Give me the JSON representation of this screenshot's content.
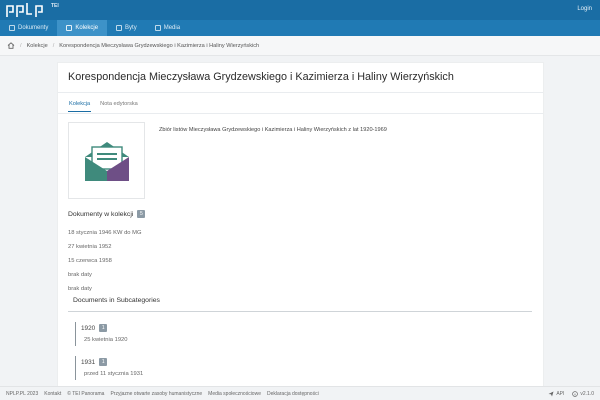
{
  "header": {
    "logo_tei": "TEI",
    "login": "Login"
  },
  "nav": {
    "items": [
      {
        "label": "Dokumenty",
        "icon": "document-icon",
        "active": false
      },
      {
        "label": "Kolekcje",
        "icon": "collection-icon",
        "active": true
      },
      {
        "label": "Byty",
        "icon": "entity-icon",
        "active": false
      },
      {
        "label": "Media",
        "icon": "media-icon",
        "active": false
      }
    ]
  },
  "breadcrumb": {
    "home_icon": "home-icon",
    "items": [
      "Kolekcje",
      "Korespondencja Mieczysława Grydzewskiego i Kazimierza i Haliny Wierzyńskich"
    ]
  },
  "collection": {
    "title": "Korespondencja Mieczysława Grydzewskiego i Kazimierza i Haliny Wierzyńskich",
    "tabs": [
      {
        "label": "Kolekcja",
        "active": true
      },
      {
        "label": "Nota edytorska",
        "active": false
      }
    ],
    "description": "Zbiór listów Mieczysława Grydzewskiego i Kazimierza i Haliny Wierzyńskich z lat 1920-1969",
    "documents_heading": "Dokumenty w kolekcji",
    "documents_count": "5",
    "documents": [
      "18 stycznia 1946 KW do MG",
      "27 kwietnia 1952",
      "15 czerwca 1958",
      "brak daty",
      "brak daty"
    ],
    "subcategories_heading": "Documents in Subcategories",
    "subcategories": [
      {
        "label": "1920",
        "count": "1",
        "items": [
          "25 kwietnia 1920"
        ]
      },
      {
        "label": "1931",
        "count": "1",
        "items": [
          "przed 11 stycznia 1931"
        ]
      }
    ]
  },
  "footer": {
    "left": [
      "NPLP.PL 2023",
      "Kontakt",
      "© TEI Panorama",
      "Przyjazne otwarte zasoby humanistyczne",
      "Media społecznościowe",
      "Deklaracja dostępności"
    ],
    "api": "API",
    "version": "v2.1.0"
  },
  "colors": {
    "brand": "#1a6da4",
    "envelope_green": "#3f8a7c",
    "envelope_purple": "#6e4f86"
  }
}
